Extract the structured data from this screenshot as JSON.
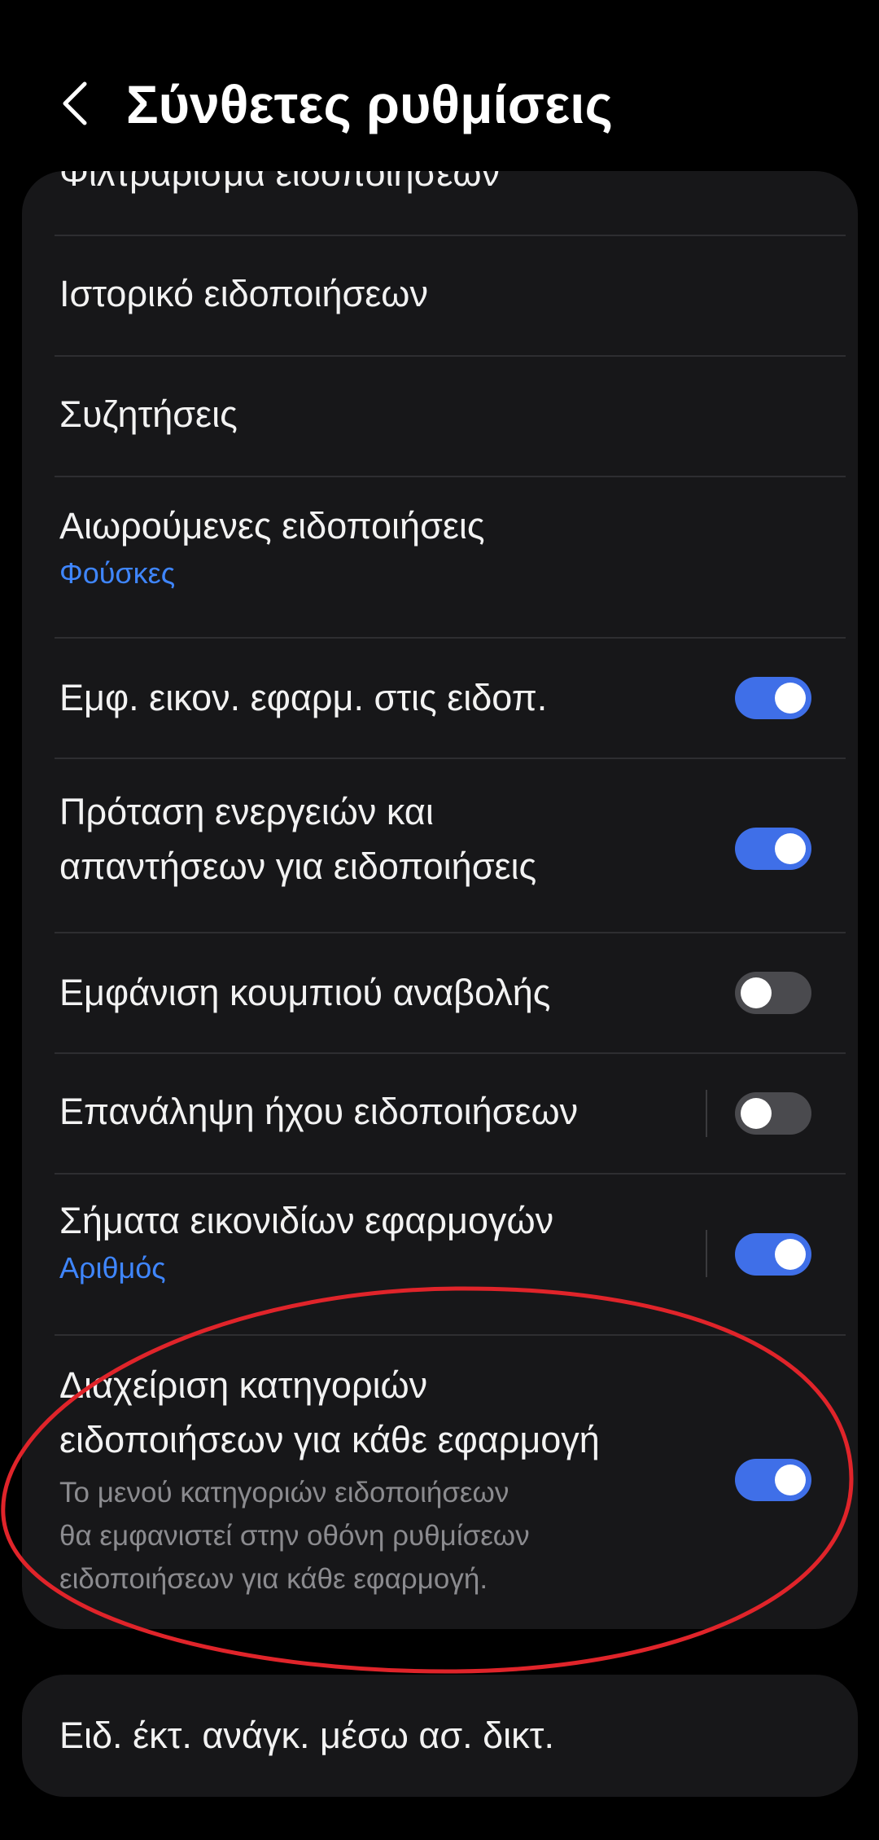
{
  "header": {
    "title": "Σύνθετες ρυθμίσεις",
    "back_icon": "chevron-left-icon"
  },
  "settings": {
    "partial_item": "Φιλτράρισμα ειδοποιήσεων",
    "items": [
      {
        "label": "Ιστορικό ειδοποιήσεων"
      },
      {
        "label": "Συζητήσεις"
      },
      {
        "label": "Αιωρούμενες ειδοποιήσεις",
        "sublabel": "Φούσκες"
      },
      {
        "label": "Εμφ. εικον. εφαρμ. στις ειδοπ.",
        "toggle": true
      },
      {
        "label_line1": "Πρόταση ενεργειών και",
        "label_line2": "απαντήσεων για ειδοποιήσεις",
        "toggle": true
      },
      {
        "label": "Εμφάνιση κουμπιού αναβολής",
        "toggle": false
      },
      {
        "label": "Επανάληψη ήχου ειδοποιήσεων",
        "toggle": false
      },
      {
        "label": "Σήματα εικονιδίων εφαρμογών",
        "sublabel": "Αριθμός",
        "toggle": true
      },
      {
        "label_line1": "Διαχείριση κατηγοριών",
        "label_line2": "ειδοποιήσεων για κάθε εφαρμογή",
        "desc_line1": "Το μενού κατηγοριών ειδοποιήσεων",
        "desc_line2": "θα εμφανιστεί στην οθόνη ρυθμίσεων",
        "desc_line3": "ειδοποιήσεων για κάθε εφαρμογή.",
        "toggle": true
      }
    ]
  },
  "bottom_card": {
    "label": "Ειδ. έκτ. ανάγκ. μέσω ασ. δικτ."
  },
  "colors": {
    "background": "#000000",
    "card": "#171719",
    "accent": "#3f6fe8",
    "sublabel": "#3f86ff",
    "annotation": "#e0242a"
  }
}
